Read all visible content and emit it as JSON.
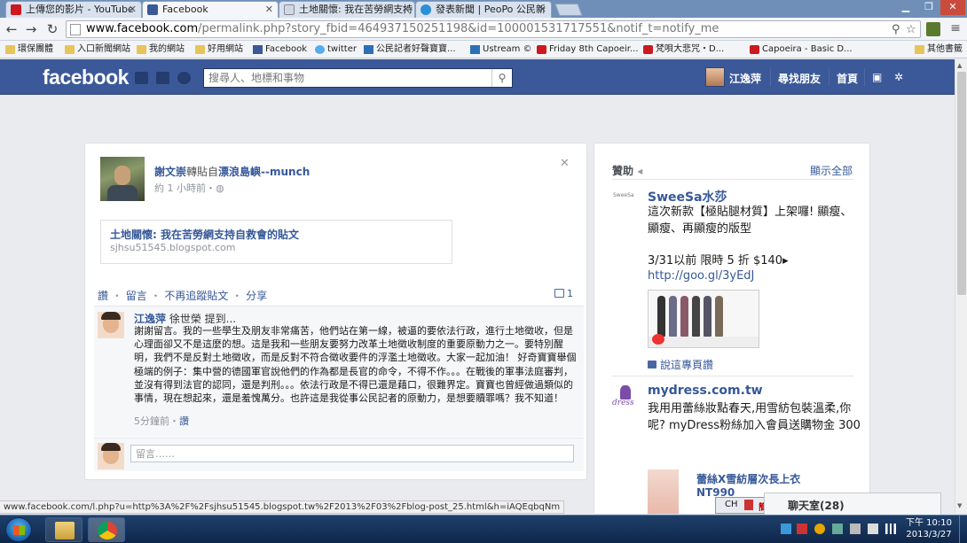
{
  "browser": {
    "tabs": [
      {
        "label": "上傳您的影片 - YouTube",
        "icon": "youtube-icon",
        "active": false
      },
      {
        "label": "Facebook",
        "icon": "facebook-icon",
        "active": true
      },
      {
        "label": "土地關懷: 我在苦勞網支持",
        "icon": "page-icon",
        "active": false
      },
      {
        "label": "發表新聞 | PeoPo 公民新",
        "icon": "peopo-icon",
        "active": false
      }
    ],
    "url_host": "www.facebook.com",
    "url_rest": "/permalink.php?story_fbid=464937150251198&id=100001531717551&notif_t=notify_me",
    "bookmarks": [
      {
        "label": "環保團體",
        "icon": "folder-icon"
      },
      {
        "label": "入口新聞網站",
        "icon": "folder-icon"
      },
      {
        "label": "我的網站",
        "icon": "folder-icon"
      },
      {
        "label": "好用網站",
        "icon": "folder-icon"
      },
      {
        "label": "Facebook",
        "icon": "facebook-icon"
      },
      {
        "label": "twitter",
        "icon": "twitter-icon"
      },
      {
        "label": "公民記者好聲寶寶...",
        "icon": "ustream-icon"
      },
      {
        "label": "Ustream ©",
        "icon": "ustream-icon"
      },
      {
        "label": "Friday 8th Capoeir...",
        "icon": "youtube-icon"
      },
      {
        "label": "梵唄大悲咒・D...",
        "icon": "youtube-icon"
      },
      {
        "label": "Capoeira - Basic D...",
        "icon": "youtube-icon"
      },
      {
        "label": "其他書籤",
        "icon": "folder-icon"
      }
    ],
    "status_url": "www.facebook.com/l.php?u=http%3A%2F%2Fsjhsu51545.blogspot.tw%2F2013%2F03%2Fblog-post_25.html&h=iAQEqbqNm"
  },
  "fb_header": {
    "logo": "facebook",
    "search_placeholder": "搜尋人、地標和事物",
    "user_name": "江逸萍",
    "find_friends": "尋找朋友",
    "home": "首頁"
  },
  "post": {
    "author": "謝文崇",
    "shared_via": "轉貼自",
    "source": "漂浪島嶼--munch",
    "time": "約 1 小時前・",
    "link_title": "土地關懷: 我在苦勞網支持自救會的貼文",
    "link_url": "sjhsu51545.blogspot.com",
    "actions": [
      "讚",
      "留言",
      "不再追蹤貼文",
      "分享"
    ],
    "comment_count": "1"
  },
  "comment": {
    "author": "江逸萍",
    "mention": "徐世榮 提到...",
    "text": "謝謝留言。我的一些學生及朋友非常痛苦，他們站在第一線，被逼的要依法行政，進行土地徵收，但是心理面卻又不是這麼的想。這是我和一些朋友要努力改革土地徵收制度的重要原動力之一。要特別醒明，我們不是反對土地徵收，而是反對不符合徵收要件的浮濫土地徵收。大家一起加油！ 好奇寶寶舉個極端的例子：集中營的德國軍官說他們的作為都是長官的命令，不得不作。。。在戰後的軍事法庭審判，並沒有得到法官的認同，還是判刑。。。依法行政是不得已還是藉口，很難界定。寶寶也曾經做過類似的事情，現在想起來，還是羞愧萬分。也許這是我從事公民記者的原動力，是想要贖罪嗎？我不知道！",
    "time": "5分鐘前・",
    "like": "讚",
    "input_placeholder": "留言……"
  },
  "sidebar": {
    "heading": "贊助",
    "see_all": "顯示全部",
    "ad1": {
      "brand_mark": "SweeSa",
      "title": "SweeSa水莎",
      "text": "這次新款【極貼腿材質】上架囉! 顯瘦、顯瘦、再顯瘦的版型",
      "promo": "3/31以前 限時 5 折 $140▸",
      "link": "http://goo.gl/3yEdJ",
      "like_page": "說這專頁讚"
    },
    "ad2": {
      "logo_word": "dress",
      "title": "mydress.com.tw",
      "text": "我用用蕾絲妝點春天,用雪紡包裝溫柔,你呢? myDress粉絲加入會員送購物金 300",
      "sub_title": "蕾絲X雪紡層次長上衣 NT990"
    }
  },
  "chat": {
    "label": "聊天室(28)",
    "ime": [
      "CH",
      "簡"
    ]
  },
  "taskbar": {
    "time": "下午 10:10",
    "date": "2013/3/27"
  },
  "colors": {
    "fb_blue": "#3b5998",
    "link_blue": "#365899",
    "page_bg": "#e9ebee"
  }
}
